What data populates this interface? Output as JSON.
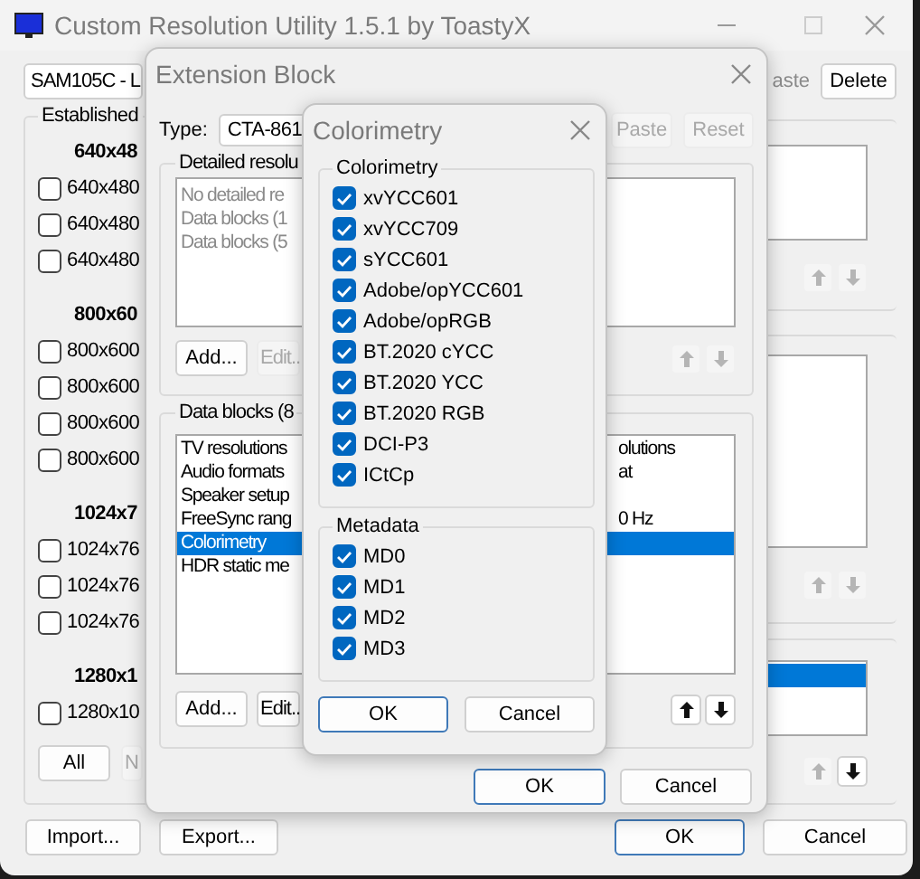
{
  "main_window": {
    "title": "Custom Resolution Utility 1.5.1 by ToastyX",
    "display_dropdown": "SAM105C - L",
    "partial_button": "aste",
    "delete_button": "Delete",
    "established": {
      "label": "Established",
      "sections": [
        {
          "header": "640x48",
          "items": [
            {
              "label": "640x480",
              "checked": false
            },
            {
              "label": "640x480",
              "checked": false
            },
            {
              "label": "640x480",
              "checked": false
            }
          ]
        },
        {
          "header": "800x60",
          "items": [
            {
              "label": "800x600",
              "checked": false
            },
            {
              "label": "800x600",
              "checked": false
            },
            {
              "label": "800x600",
              "checked": false
            },
            {
              "label": "800x600",
              "checked": false
            }
          ]
        },
        {
          "header": "1024x7",
          "items": [
            {
              "label": "1024x76",
              "checked": false
            },
            {
              "label": "1024x76",
              "checked": false
            },
            {
              "label": "1024x76",
              "checked": false
            }
          ]
        },
        {
          "header": "1280x1",
          "items": [
            {
              "label": "1280x10",
              "checked": false
            }
          ]
        }
      ],
      "buttons": [
        {
          "label": "All",
          "disabled": false
        },
        {
          "label": "N",
          "disabled": true
        }
      ]
    },
    "lists": [
      {
        "highlighted": false,
        "up_enabled": false,
        "down_enabled": false
      },
      {
        "highlighted": false,
        "up_enabled": false,
        "down_enabled": false
      },
      {
        "highlighted": true,
        "up_enabled": false,
        "down_enabled": true
      }
    ],
    "buttons": [
      {
        "label": "Import...",
        "default": false
      },
      {
        "label": "Export...",
        "default": false
      },
      {
        "label": "OK",
        "default": true
      },
      {
        "label": "Cancel",
        "default": false
      }
    ]
  },
  "extension_block": {
    "title": "Extension Block",
    "type_label": "Type:",
    "type_value": "CTA-861",
    "tool_buttons": [
      {
        "label": "Paste",
        "disabled": true
      },
      {
        "label": "Reset",
        "disabled": true
      }
    ],
    "detailed": {
      "label": "Detailed resolu",
      "rows": [
        {
          "text": "No detailed re"
        },
        {
          "text": "Data blocks (1"
        },
        {
          "text": "Data blocks (5"
        }
      ],
      "buttons": [
        {
          "label": "Add...",
          "disabled": false
        },
        {
          "label": "Edit..",
          "disabled": true
        }
      ],
      "up_enabled": false,
      "down_enabled": false
    },
    "data_blocks": {
      "label": "Data blocks (8",
      "rows": [
        {
          "text": "TV resolutions",
          "tail": "olutions",
          "selected": false
        },
        {
          "text": "Audio formats",
          "tail": "at",
          "selected": false
        },
        {
          "text": "Speaker setup",
          "selected": false
        },
        {
          "text": "FreeSync rang",
          "tail": "0 Hz",
          "selected": false
        },
        {
          "text": "Colorimetry",
          "selected": true
        },
        {
          "text": "HDR static me",
          "selected": false
        }
      ],
      "buttons": [
        {
          "label": "Add...",
          "disabled": false
        },
        {
          "label": "Edit..",
          "disabled": false
        }
      ],
      "up_enabled": true,
      "down_enabled": true
    },
    "buttons": [
      {
        "label": "OK",
        "default": true
      },
      {
        "label": "Cancel",
        "default": false
      }
    ]
  },
  "colorimetry_dialog": {
    "title": "Colorimetry",
    "groups": [
      {
        "label": "Colorimetry",
        "items": [
          {
            "label": "xvYCC601",
            "checked": true
          },
          {
            "label": "xvYCC709",
            "checked": true
          },
          {
            "label": "sYCC601",
            "checked": true
          },
          {
            "label": "Adobe/opYCC601",
            "checked": true
          },
          {
            "label": "Adobe/opRGB",
            "checked": true
          },
          {
            "label": "BT.2020 cYCC",
            "checked": true
          },
          {
            "label": "BT.2020 YCC",
            "checked": true
          },
          {
            "label": "BT.2020 RGB",
            "checked": true
          },
          {
            "label": "DCI-P3",
            "checked": true
          },
          {
            "label": "ICtCp",
            "checked": true
          }
        ]
      },
      {
        "label": "Metadata",
        "items": [
          {
            "label": "MD0",
            "checked": true
          },
          {
            "label": "MD1",
            "checked": true
          },
          {
            "label": "MD2",
            "checked": true
          },
          {
            "label": "MD3",
            "checked": true
          }
        ]
      }
    ],
    "buttons": [
      {
        "label": "OK",
        "default": true
      },
      {
        "label": "Cancel",
        "default": false
      }
    ]
  }
}
